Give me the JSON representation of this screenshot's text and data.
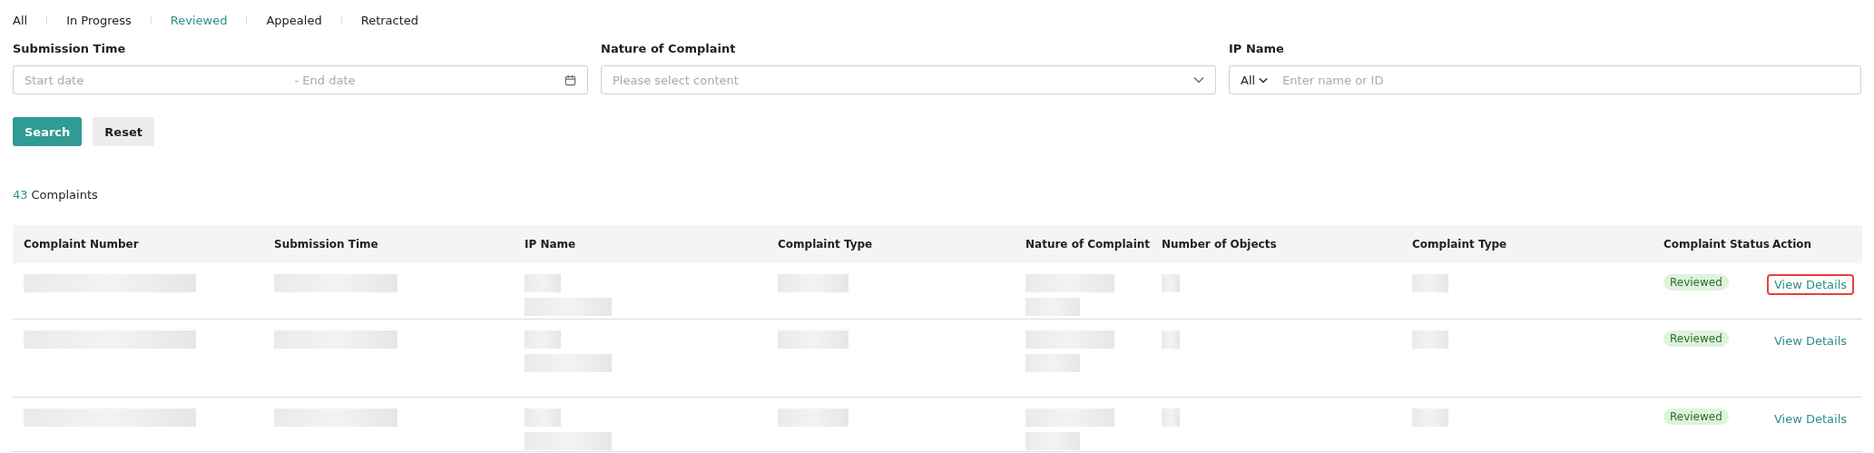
{
  "tabs": [
    {
      "label": "All",
      "selected": false
    },
    {
      "label": "In Progress",
      "selected": false
    },
    {
      "label": "Reviewed",
      "selected": true
    },
    {
      "label": "Appealed",
      "selected": false
    },
    {
      "label": "Retracted",
      "selected": false
    }
  ],
  "filters": {
    "submission_time": {
      "label": "Submission Time",
      "start_placeholder": "Start date",
      "separator": "-",
      "end_placeholder": "End date"
    },
    "nature_of_complaint": {
      "label": "Nature of Complaint",
      "placeholder": "Please select content"
    },
    "ip_name": {
      "label": "IP Name",
      "scope": "All",
      "placeholder": "Enter name or ID"
    }
  },
  "buttons": {
    "search": "Search",
    "reset": "Reset"
  },
  "summary": {
    "count": "43",
    "label": "Complaints"
  },
  "table": {
    "columns": [
      "Complaint Number",
      "Submission Time",
      "IP Name",
      "Complaint Type",
      "Nature of Complaint",
      "Number of Objects",
      "Complaint Type",
      "Complaint Status",
      "Action"
    ],
    "rows": [
      {
        "status": "Reviewed",
        "action": "View Details",
        "highlighted": true
      },
      {
        "status": "Reviewed",
        "action": "View Details",
        "highlighted": false
      },
      {
        "status": "Reviewed",
        "action": "View Details",
        "highlighted": false
      }
    ]
  }
}
